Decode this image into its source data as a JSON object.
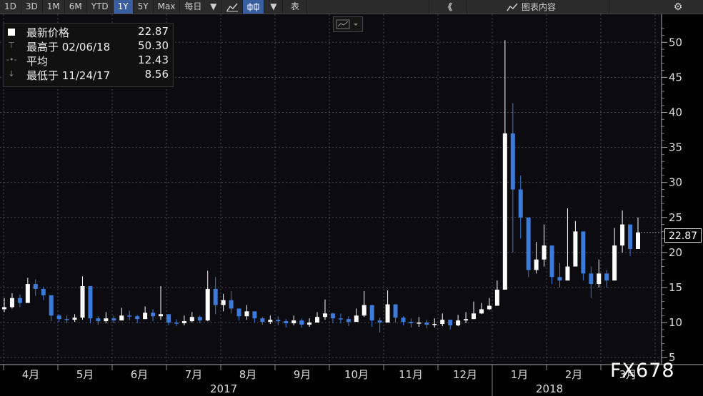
{
  "toolbar": {
    "periods": [
      "1D",
      "3D",
      "1M",
      "6M",
      "YTD",
      "1Y",
      "5Y",
      "Max"
    ],
    "active_period": "1Y",
    "frequency": "每日",
    "frequency_arrow": "▼",
    "chart_type_arrow": "▼",
    "table_label": "表",
    "collapse_label": "《",
    "chart_content_label": "图表内容",
    "icons": [
      "line-chart-icon",
      "candlestick-icon",
      "collapse-icon",
      "chart-content-icon",
      "gear-icon"
    ]
  },
  "legend": {
    "rows": [
      {
        "label": "最新价格",
        "value": "22.87",
        "symbol": "square"
      },
      {
        "label": "最高于 02/06/18",
        "value": "50.30",
        "symbol": "T"
      },
      {
        "label": "平均",
        "value": "12.43",
        "symbol": "dot-line"
      },
      {
        "label": "最低于 11/24/17",
        "value": "8.56",
        "symbol": "down-arrow"
      }
    ]
  },
  "price_tag": "22.87",
  "watermark": "FX678",
  "colors": {
    "up": "#ffffff",
    "down": "#3b7bd9",
    "grid": "#4a4a55",
    "background": "#0b0b10"
  },
  "chart_data": {
    "type": "candlestick",
    "title": "",
    "ylabel": "",
    "xlabel": "",
    "ylim": [
      4,
      54
    ],
    "yticks": [
      5,
      10,
      15,
      20,
      25,
      30,
      35,
      40,
      45,
      50
    ],
    "grid": "dotted",
    "months": [
      "4月",
      "5月",
      "6月",
      "7月",
      "8月",
      "9月",
      "10月",
      "11月",
      "12月",
      "1月",
      "2月",
      "3月"
    ],
    "years": [
      "2017",
      "2018"
    ],
    "summary": {
      "last": 22.87,
      "high": 50.3,
      "high_date": "02/06/18",
      "average": 12.43,
      "low": 8.56,
      "low_date": "11/24/17"
    },
    "weekly_close": [
      12.2,
      13.5,
      12.8,
      15.5,
      14.8,
      13.9,
      11.0,
      10.5,
      10.4,
      10.7,
      15.2,
      10.6,
      10.2,
      10.6,
      10.3,
      11.0,
      10.9,
      10.5,
      11.4,
      10.9,
      11.2,
      10.0,
      9.9,
      10.2,
      10.8,
      10.3,
      14.8,
      12.5,
      13.2,
      12.0,
      10.9,
      11.6,
      10.6,
      10.1,
      10.4,
      10.2,
      9.9,
      10.3,
      9.7,
      10.0,
      10.8,
      11.3,
      10.6,
      10.5,
      10.1,
      11.0,
      12.5,
      10.3,
      10.0,
      12.6,
      10.7,
      10.1,
      9.9,
      10.0,
      9.7,
      9.8,
      10.4,
      9.6,
      10.3,
      10.5,
      11.3,
      11.9,
      12.4,
      14.7,
      37.0,
      29.0,
      25.0,
      17.5,
      19.0,
      21.0,
      16.5,
      16.0,
      18.0,
      23.0,
      17.0,
      15.5,
      17.0,
      16.0,
      21.0,
      24.0,
      20.5,
      22.87
    ],
    "weekly_high": [
      13.5,
      14.2,
      14.0,
      16.4,
      16.2,
      15.1,
      12.0,
      11.2,
      11.0,
      11.2,
      16.6,
      12.5,
      10.9,
      11.5,
      11.0,
      12.1,
      11.7,
      11.1,
      12.3,
      11.9,
      15.2,
      10.8,
      10.5,
      11.0,
      11.5,
      11.0,
      17.4,
      16.5,
      14.1,
      14.5,
      12.0,
      12.5,
      11.3,
      10.8,
      11.0,
      10.9,
      10.5,
      11.0,
      10.6,
      10.6,
      11.5,
      13.3,
      11.4,
      11.3,
      10.9,
      12.0,
      14.5,
      11.1,
      10.7,
      14.6,
      11.5,
      10.9,
      10.6,
      10.8,
      10.4,
      10.6,
      11.3,
      10.3,
      11.1,
      11.5,
      13.0,
      12.8,
      13.5,
      16.0,
      50.3,
      41.3,
      31.0,
      22.5,
      21.5,
      24.0,
      19.0,
      18.5,
      26.3,
      24.5,
      21.0,
      18.0,
      19.0,
      17.5,
      23.5,
      26.0,
      24.0,
      25.0
    ],
    "weekly_low": [
      11.5,
      12.0,
      12.2,
      13.8,
      13.8,
      13.2,
      10.2,
      10.1,
      9.9,
      10.1,
      10.4,
      9.9,
      9.7,
      9.9,
      9.9,
      10.3,
      10.3,
      9.9,
      10.5,
      10.2,
      10.4,
      9.6,
      9.5,
      9.6,
      10.0,
      9.9,
      10.2,
      11.2,
      11.6,
      11.3,
      10.3,
      10.4,
      10.0,
      9.7,
      9.8,
      9.6,
      9.3,
      9.6,
      9.3,
      9.4,
      10.0,
      10.4,
      9.9,
      9.9,
      9.5,
      10.2,
      10.8,
      9.4,
      8.56,
      10.4,
      10.0,
      9.6,
      9.3,
      9.4,
      9.2,
      9.3,
      9.5,
      9.0,
      9.5,
      9.9,
      10.5,
      11.2,
      11.8,
      12.8,
      16.0,
      20.0,
      22.0,
      16.5,
      17.0,
      18.0,
      15.5,
      15.0,
      16.5,
      18.0,
      16.0,
      13.5,
      15.0,
      15.0,
      16.5,
      20.0,
      19.5,
      21.0
    ]
  }
}
